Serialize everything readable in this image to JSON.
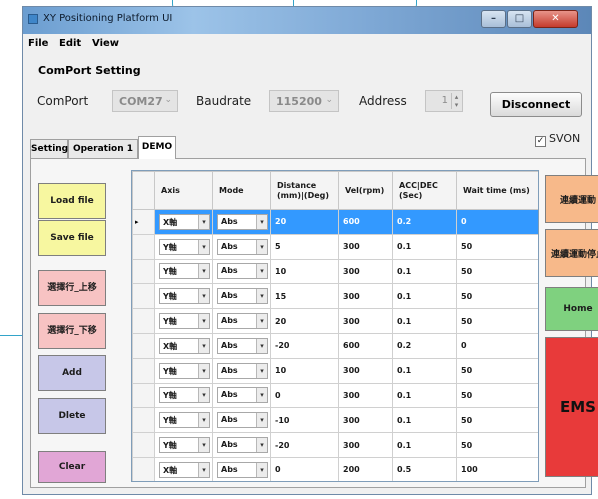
{
  "window": {
    "title": "XY Positioning Platform UI",
    "controls": {
      "minimize": "–",
      "maximize": "□",
      "close": "✕"
    }
  },
  "menu": [
    "File",
    "Edit",
    "View"
  ],
  "comport_setting": {
    "title": "ComPort Setting",
    "comport_label": "ComPort",
    "comport_value": "COM27",
    "baudrate_label": "Baudrate",
    "baudrate_value": "115200",
    "address_label": "Address",
    "address_value": "1",
    "disconnect_label": "Disconnect"
  },
  "svon": {
    "label": "SVON",
    "checked": true
  },
  "tabs": [
    {
      "label": "Setting",
      "active": false
    },
    {
      "label": "Operation 1",
      "active": false
    },
    {
      "label": "DEMO",
      "active": true
    }
  ],
  "left_buttons": [
    {
      "label": "Load file",
      "color": "#f7f7a0"
    },
    {
      "label": "Save file",
      "color": "#f7f7a0"
    },
    {
      "label": "選擇行_上移",
      "color": "#f7c3c3"
    },
    {
      "label": "選擇行_下移",
      "color": "#f7c3c3"
    },
    {
      "label": "Add",
      "color": "#c7c7e8"
    },
    {
      "label": "Dlete",
      "color": "#c7c7e8"
    },
    {
      "label": "Clear",
      "color": "#e1a6d6"
    }
  ],
  "right_buttons": [
    {
      "label": "連續運動",
      "color": "#f7b98a"
    },
    {
      "label": "連續運動停止",
      "color": "#f7b98a"
    },
    {
      "label": "Home",
      "color": "#7fd17f"
    },
    {
      "label": "EMS",
      "color": "#e83a3a"
    }
  ],
  "grid": {
    "columns": [
      "Axis",
      "Mode",
      "Distance (mm)|(Deg)",
      "Vel(rpm)",
      "ACC|DEC (Sec)",
      "Wait time (ms)"
    ],
    "selected_row": 0,
    "row_indicator": "▸",
    "rows": [
      [
        "X軸",
        "Abs",
        "20",
        "600",
        "0.2",
        "0"
      ],
      [
        "Y軸",
        "Abs",
        "5",
        "300",
        "0.1",
        "50"
      ],
      [
        "Y軸",
        "Abs",
        "10",
        "300",
        "0.1",
        "50"
      ],
      [
        "Y軸",
        "Abs",
        "15",
        "300",
        "0.1",
        "50"
      ],
      [
        "Y軸",
        "Abs",
        "20",
        "300",
        "0.1",
        "50"
      ],
      [
        "X軸",
        "Abs",
        "-20",
        "600",
        "0.2",
        "0"
      ],
      [
        "Y軸",
        "Abs",
        "10",
        "300",
        "0.1",
        "50"
      ],
      [
        "Y軸",
        "Abs",
        "0",
        "300",
        "0.1",
        "50"
      ],
      [
        "Y軸",
        "Abs",
        "-10",
        "300",
        "0.1",
        "50"
      ],
      [
        "Y軸",
        "Abs",
        "-20",
        "300",
        "0.1",
        "50"
      ],
      [
        "X軸",
        "Abs",
        "0",
        "200",
        "0.5",
        "100"
      ],
      [
        "Y軸",
        "Abs",
        "0",
        "200",
        "0.5",
        "100"
      ]
    ]
  }
}
